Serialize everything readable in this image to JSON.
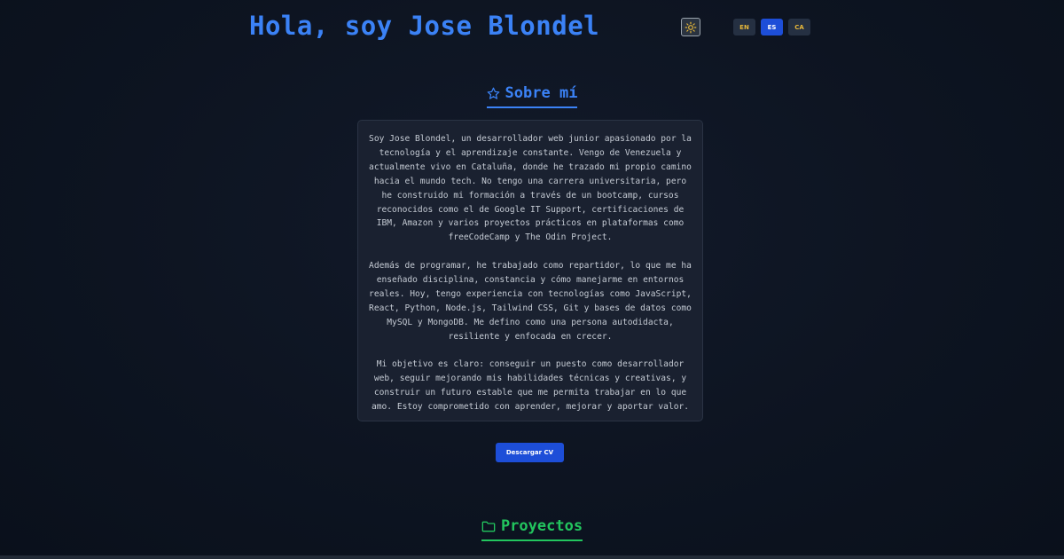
{
  "header": {
    "title": "Hola, soy Jose Blondel",
    "theme_icon": "sun-icon",
    "languages": [
      {
        "code": "EN",
        "active": false
      },
      {
        "code": "ES",
        "active": true
      },
      {
        "code": "CA",
        "active": false
      }
    ]
  },
  "about": {
    "heading": "Sobre mí",
    "heading_icon": "star-outline-icon",
    "paragraphs": [
      "Soy Jose Blondel, un desarrollador web junior apasionado por la tecnología y el aprendizaje constante. Vengo de Venezuela y actualmente vivo en Cataluña, donde he trazado mi propio camino hacia el mundo tech. No tengo una carrera universitaria, pero he construido mi formación a través de un bootcamp, cursos reconocidos como el de Google IT Support, certificaciones de IBM, Amazon y varios proyectos prácticos en plataformas como freeCodeCamp y The Odin Project.",
      "Además de programar, he trabajado como repartidor, lo que me ha enseñado disciplina, constancia y cómo manejarme en entornos reales. Hoy, tengo experiencia con tecnologías como JavaScript, React, Python, Node.js, Tailwind CSS, Git y bases de datos como MySQL y MongoDB. Me defino como una persona autodidacta, resiliente y enfocada en crecer.",
      "Mi objetivo es claro: conseguir un puesto como desarrollador web, seguir mejorando mis habilidades técnicas y creativas, y construir un futuro estable que me permita trabajar en lo que amo. Estoy comprometido con aprender, mejorar y aportar valor."
    ],
    "cv_button": "Descargar CV"
  },
  "projects": {
    "heading": "Proyectos",
    "heading_icon": "folder-icon"
  },
  "colors": {
    "background": "#0d1421",
    "accent_blue": "#3b82f6",
    "button_blue": "#1d4ed8",
    "accent_green": "#22c55e",
    "lang_text": "#e7b83a"
  }
}
